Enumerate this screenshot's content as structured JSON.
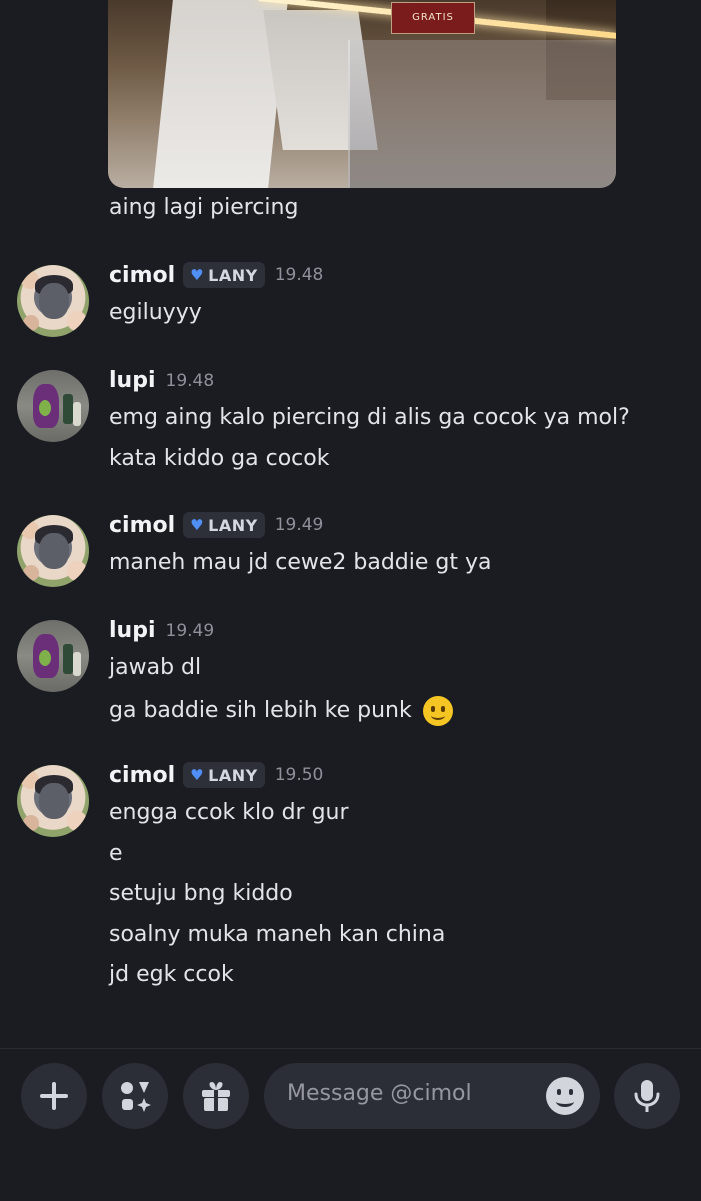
{
  "attachment": {
    "caption": "aing lagi piercing",
    "sign_text": "GRATIS"
  },
  "messages": [
    {
      "author": "cimol",
      "avatar": "cimol",
      "role_tag": "LANY",
      "role_icon": "blue-heart-icon",
      "time": "19.48",
      "lines": [
        "egiluyyy"
      ]
    },
    {
      "author": "lupi",
      "avatar": "lupi",
      "role_tag": "",
      "time": "19.48",
      "lines": [
        "emg aing kalo piercing di alis ga cocok ya mol?",
        "kata kiddo ga cocok"
      ]
    },
    {
      "author": "cimol",
      "avatar": "cimol",
      "role_tag": "LANY",
      "role_icon": "blue-heart-icon",
      "time": "19.49",
      "lines": [
        "maneh mau jd cewe2 baddie gt ya"
      ]
    },
    {
      "author": "lupi",
      "avatar": "lupi",
      "role_tag": "",
      "time": "19.49",
      "lines": [
        "jawab dl",
        "ga baddie sih lebih ke punk"
      ],
      "line_emoji": "slightly-smiling-face-icon"
    },
    {
      "author": "cimol",
      "avatar": "cimol",
      "role_tag": "LANY",
      "role_icon": "blue-heart-icon",
      "time": "19.50",
      "lines": [
        "engga ccok klo dr gur",
        "e",
        "setuju bng kiddo",
        "soalny muka maneh kan china",
        "jd egk ccok"
      ]
    }
  ],
  "composer": {
    "placeholder": "Message @cimol",
    "buttons": [
      "plus-icon",
      "apps-icon",
      "gift-icon",
      "microphone-icon"
    ]
  },
  "colors": {
    "background": "#1b1c22",
    "input_bg": "#2b2d37",
    "role_heart": "#4f8ff7"
  }
}
